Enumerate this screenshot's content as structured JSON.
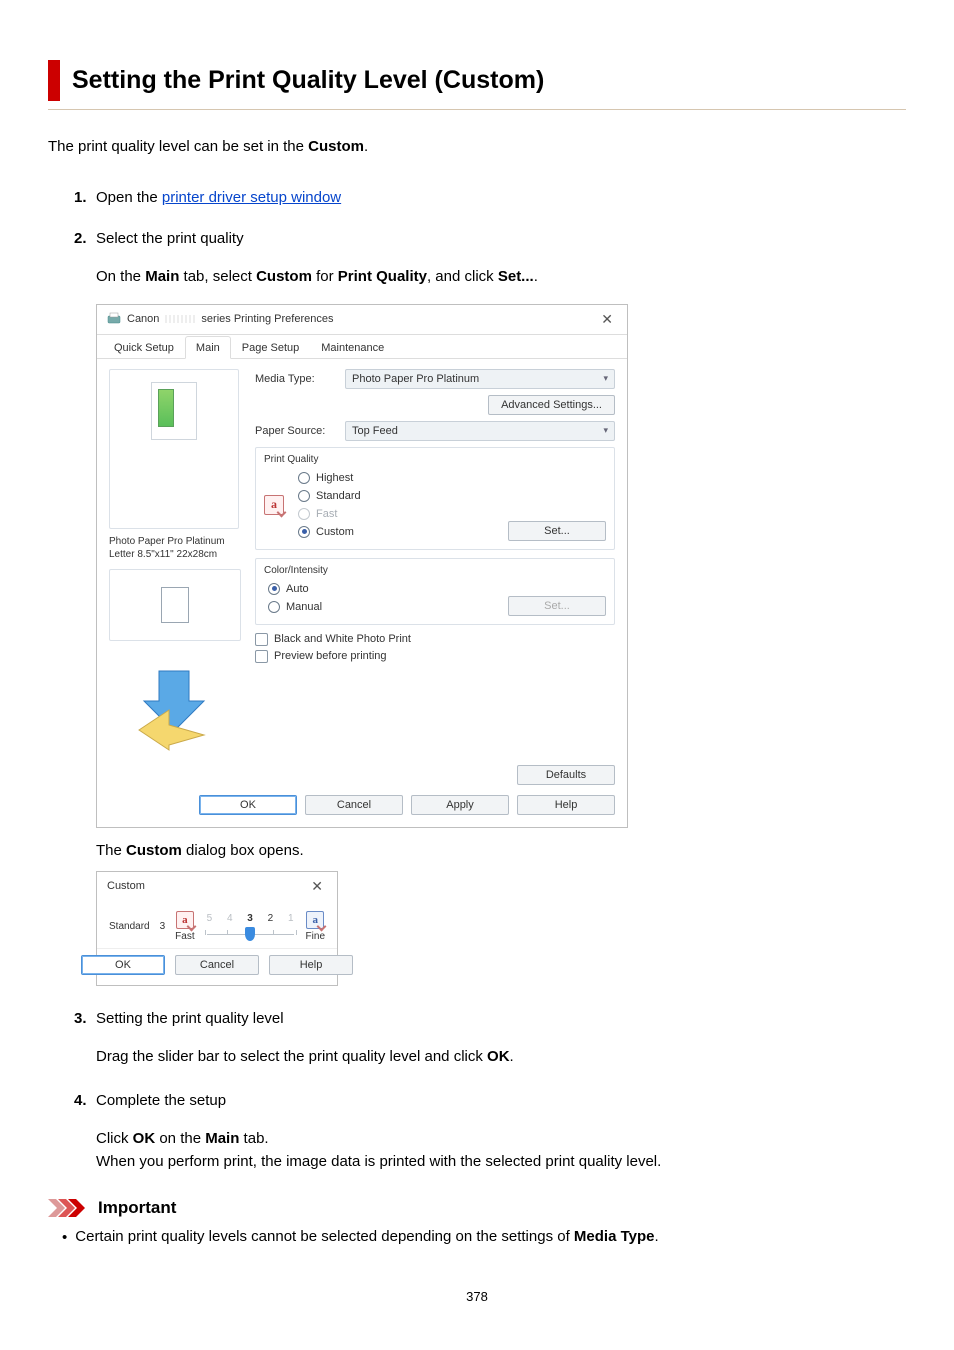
{
  "page": {
    "title": "Setting the Print Quality Level (Custom)",
    "number": 378,
    "intro_pre": "The print quality level can be set in the ",
    "intro_bold": "Custom",
    "intro_post": "."
  },
  "steps": {
    "s1": {
      "num": "1.",
      "pre": "Open the ",
      "link": "printer driver setup window"
    },
    "s2": {
      "num": "2.",
      "title": "Select the print quality",
      "body_pre": "On the ",
      "body_b1": "Main",
      "body_mid1": " tab, select ",
      "body_b2": "Custom",
      "body_mid2": " for ",
      "body_b3": "Print Quality",
      "body_mid3": ", and click ",
      "body_b4": "Set...",
      "body_post": ".",
      "caption_pre": "The ",
      "caption_bold": "Custom",
      "caption_post": " dialog box opens."
    },
    "s3": {
      "num": "3.",
      "title": "Setting the print quality level",
      "body_pre": "Drag the slider bar to select the print quality level and click ",
      "body_bold": "OK",
      "body_post": "."
    },
    "s4": {
      "num": "4.",
      "title": "Complete the setup",
      "l1_pre": "Click ",
      "l1_b1": "OK",
      "l1_mid": " on the ",
      "l1_b2": "Main",
      "l1_post": " tab.",
      "l2": "When you perform print, the image data is printed with the selected print quality level."
    }
  },
  "dialog": {
    "title_prefix": "Canon",
    "title_suffix": "series Printing Preferences",
    "close": "✕",
    "tabs": {
      "quick": "Quick Setup",
      "main": "Main",
      "page": "Page Setup",
      "maint": "Maintenance"
    },
    "media_label": "Media Type:",
    "media_value": "Photo Paper Pro Platinum",
    "adv_settings": "Advanced Settings...",
    "paper_src_label": "Paper Source:",
    "paper_src_value": "Top Feed",
    "pq": {
      "group": "Print Quality",
      "highest": "Highest",
      "standard": "Standard",
      "fast": "Fast",
      "custom": "Custom",
      "set": "Set..."
    },
    "ci": {
      "group": "Color/Intensity",
      "auto": "Auto",
      "manual": "Manual",
      "set": "Set..."
    },
    "bw": "Black and White Photo Print",
    "preview": "Preview before printing",
    "paper_info1": "Photo Paper Pro Platinum",
    "paper_info2": "Letter 8.5\"x11\" 22x28cm",
    "defaults": "Defaults",
    "ok": "OK",
    "cancel": "Cancel",
    "apply": "Apply",
    "help": "Help"
  },
  "custom_dlg": {
    "title": "Custom",
    "close": "✕",
    "level_label": "Standard",
    "level_value": "3",
    "ticks": {
      "t5": "5",
      "t4": "4",
      "t3": "3",
      "t2": "2",
      "t1": "1"
    },
    "fast": "Fast",
    "fine": "Fine",
    "ok": "OK",
    "cancel": "Cancel",
    "help": "Help"
  },
  "important": {
    "label": "Important",
    "item_pre": "Certain print quality levels cannot be selected depending on the settings of ",
    "item_bold": "Media Type",
    "item_post": "."
  },
  "icons": {
    "a": "a"
  }
}
